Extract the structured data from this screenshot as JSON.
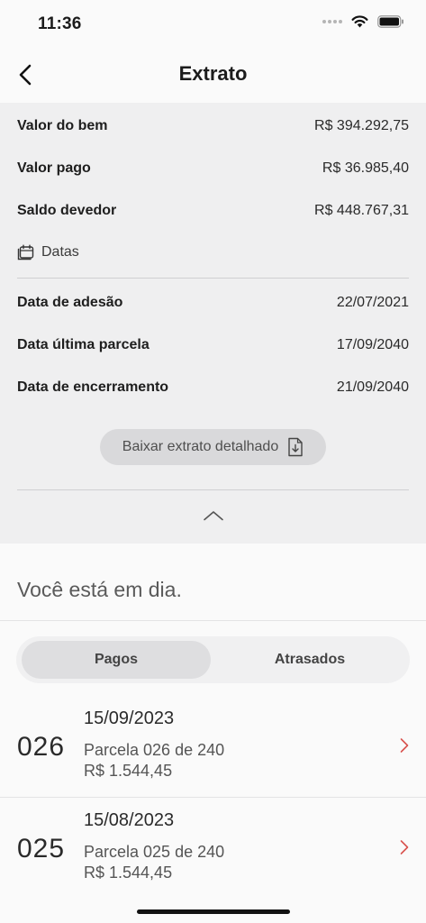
{
  "status_bar": {
    "time": "11:36"
  },
  "nav": {
    "title": "Extrato"
  },
  "summary": {
    "rows": [
      {
        "label": "Valor do bem",
        "value": "R$ 394.292,75"
      },
      {
        "label": "Valor pago",
        "value": "R$ 36.985,40"
      },
      {
        "label": "Saldo devedor",
        "value": "R$ 448.767,31"
      }
    ],
    "dates_heading": "Datas",
    "date_rows": [
      {
        "label": "Data de adesão",
        "value": "22/07/2021"
      },
      {
        "label": "Data última parcela",
        "value": "17/09/2040"
      },
      {
        "label": "Data de encerramento",
        "value": "21/09/2040"
      }
    ],
    "download_label": "Baixar extrato detalhado"
  },
  "status_message": "Você está em dia.",
  "tabs": [
    {
      "label": "Pagos",
      "active": true
    },
    {
      "label": "Atrasados",
      "active": false
    }
  ],
  "installments": [
    {
      "number": "026",
      "date": "15/09/2023",
      "description": "Parcela 026 de 240",
      "amount": "R$ 1.544,45"
    },
    {
      "number": "025",
      "date": "15/08/2023",
      "description": "Parcela 025 de 240",
      "amount": "R$ 1.544,45"
    }
  ],
  "colors": {
    "accent_chevron": "#d9534f",
    "summary_bg": "#efeff0"
  },
  "icons": {
    "back": "chevron-left-icon",
    "dates": "calendar-icon",
    "download": "file-download-icon",
    "collapse": "chevron-up-icon",
    "row_arrow": "chevron-right-icon"
  }
}
